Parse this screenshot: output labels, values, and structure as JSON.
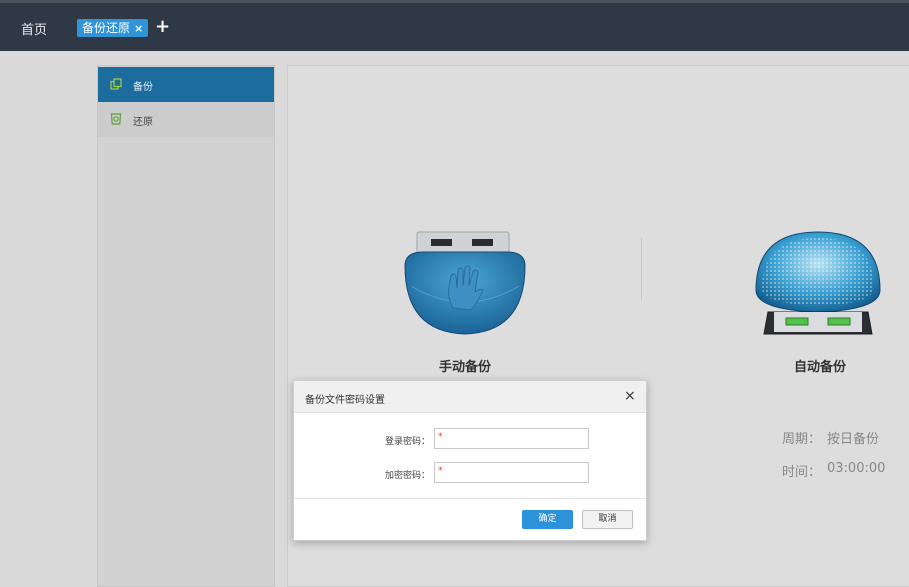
{
  "header": {
    "home_label": "首页",
    "tab_label": "备份还原",
    "tab_close": "×",
    "add_tab": "+"
  },
  "sidebar": {
    "items": [
      {
        "label": "备份",
        "icon": "copy-icon",
        "active": true
      },
      {
        "label": "还原",
        "icon": "restore-icon",
        "active": false
      }
    ]
  },
  "main": {
    "manual_backup": {
      "caption": "手动备份",
      "icon": "hand-icon"
    },
    "auto_backup": {
      "caption": "自动备份",
      "period_label": "周期：",
      "period_value": "按日备份",
      "time_label": "时间：",
      "time_value": "03:00:00"
    }
  },
  "dialog": {
    "title": "备份文件密码设置",
    "close": "×",
    "login_password_label": "登录密码：",
    "encrypt_password_label": "加密密码：",
    "required_mark": "*",
    "ok_label": "确定",
    "cancel_label": "取消"
  },
  "colors": {
    "topbar": "#2f3945",
    "accent": "#2f95d8",
    "sidebar_active": "#1c6d9e",
    "required": "#e23b3b"
  }
}
